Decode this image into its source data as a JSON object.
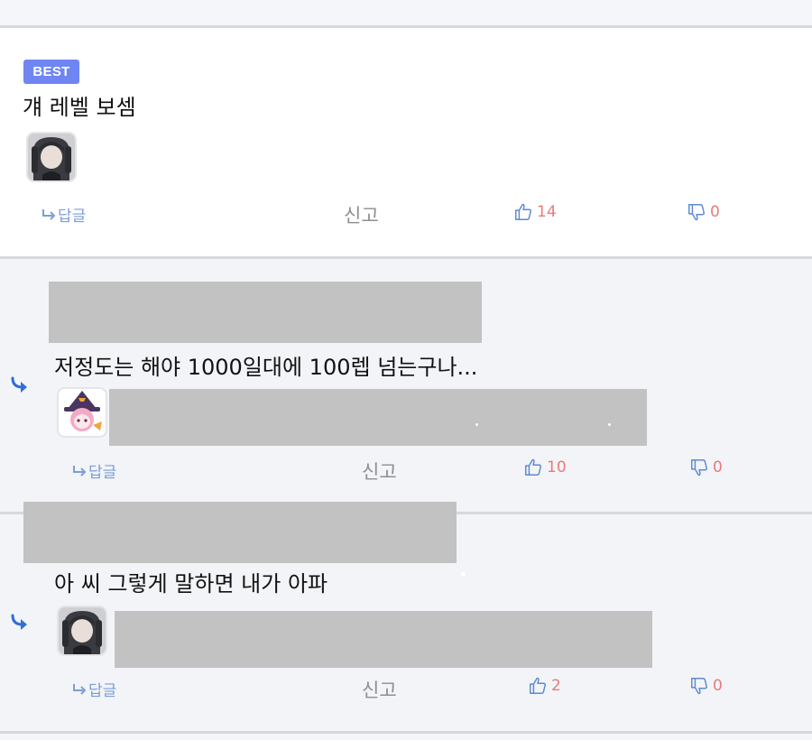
{
  "best_comment": {
    "badge": "BEST",
    "text": "걔 레벨 보셈",
    "reply_label": "답글",
    "report_label": "신고",
    "upvotes": "14",
    "downvotes": "0"
  },
  "replies": [
    {
      "text": "저정도는 해야 1000일대에 100렙 넘는구나...",
      "reply_label": "답글",
      "report_label": "신고",
      "upvotes": "10",
      "downvotes": "0"
    },
    {
      "text": "아 씨 그렇게 말하면 내가 아파",
      "reply_label": "답글",
      "report_label": "신고",
      "upvotes": "2",
      "downvotes": "0"
    }
  ],
  "icons": {
    "reply": "reply-arrow-icon",
    "upvote": "thumbs-up-icon",
    "downvote": "thumbs-down-icon"
  },
  "colors": {
    "badge": "#6f86f2",
    "vote_count": "#e87b7b",
    "reply_link": "#7a9ed6",
    "thread_arrow": "#2f6fd6"
  }
}
